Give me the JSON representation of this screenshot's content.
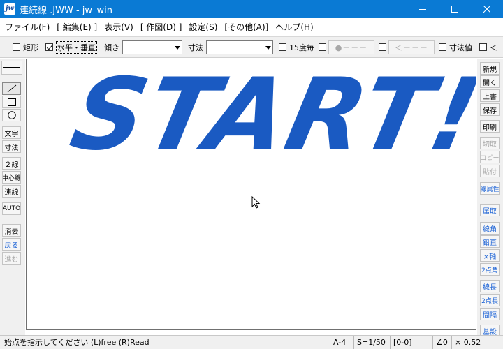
{
  "window": {
    "app_icon_text": "jw",
    "title": "連続線 .JWW - jw_win"
  },
  "menu": [
    "ファイル(F)",
    "[ 編集(E) ]",
    "表示(V)",
    "[ 作図(D) ]",
    "設定(S)",
    "[その他(A)]",
    "ヘルプ(H)"
  ],
  "toolbar": {
    "rect_label": "矩形",
    "rect_checked": false,
    "hv_label": "水平・垂直",
    "hv_checked": true,
    "tilt_label": "傾き",
    "tilt_value": "",
    "dim_label": "寸法",
    "dim_value": "",
    "deg15_label": "15度毎",
    "deg15_checked": false,
    "point_btn": "●－－－",
    "arrow_btn": "＜－－－",
    "dimval_label": "寸法値",
    "last_label": "＜"
  },
  "left_tools": {
    "line_style_icon": "line-style-icon",
    "line_icon": "line-icon",
    "rect_icon": "rectangle-icon",
    "circle_icon": "circle-icon",
    "text": "文字",
    "dim": "寸法",
    "double_line": "２線",
    "center_line": "中心線",
    "polyline": "連線",
    "auto": "AUTO",
    "erase": "消去",
    "undo": "戻る",
    "redo": "進む"
  },
  "right_tools": {
    "new": "新規",
    "open": "開く",
    "save_over": "上書",
    "save": "保存",
    "print": "印刷",
    "cut": "切取",
    "copy": "コピー",
    "paste": "貼付",
    "layer_attr": "線属性",
    "attr_get": "属取",
    "line_angle": "線角",
    "vertical": "鉛直",
    "x_axis": "×軸",
    "two_pt_angle": "2点角",
    "line_len": "線長",
    "two_pt_len": "2点長",
    "spacing": "間隔",
    "basic": "基設"
  },
  "canvas": {
    "text": "START!",
    "text_color": "#1a5ac2"
  },
  "status": {
    "message": "始点を指示してください (L)free (R)Read",
    "paper": "A-4",
    "scale": "S=1/50",
    "layer": "[0-0]",
    "angle": "∠0",
    "zoom": "× 0.52"
  }
}
